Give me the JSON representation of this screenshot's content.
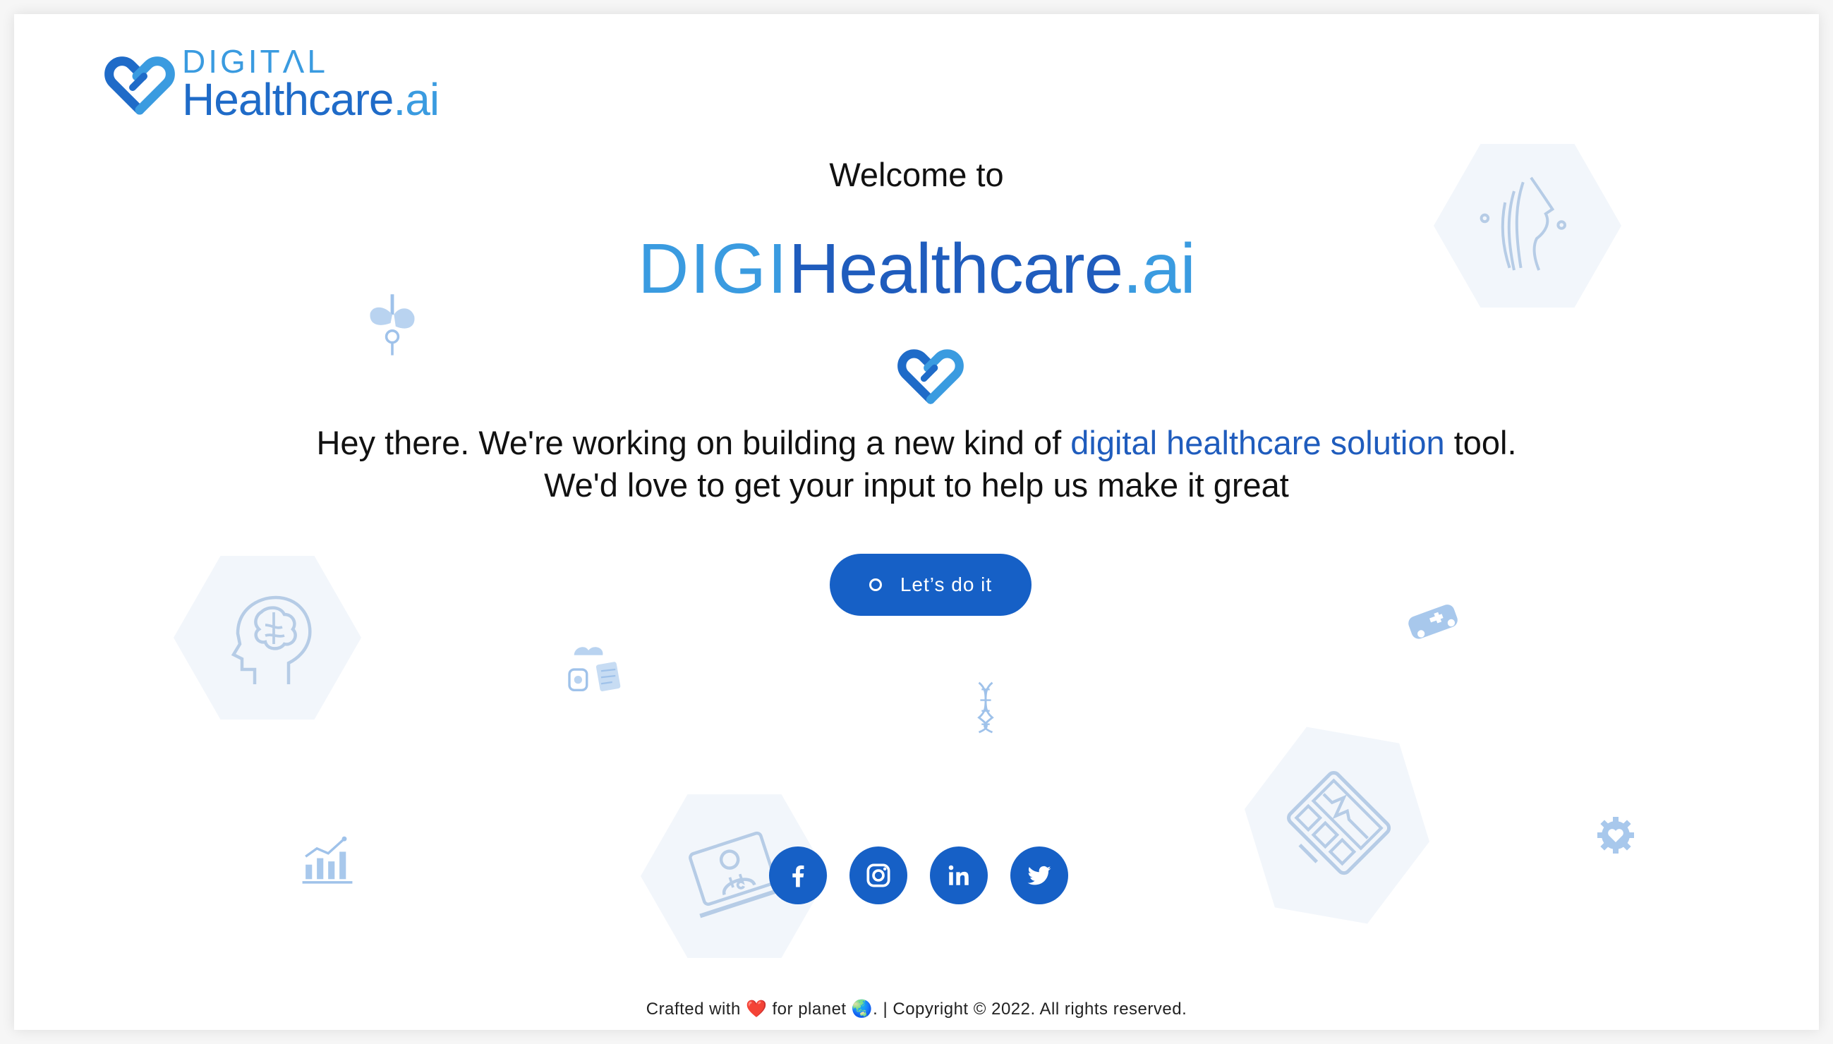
{
  "logo": {
    "line1": "DIGITΛL",
    "line2_main": "Healthcare",
    "line2_suffix": ".ai"
  },
  "hero": {
    "welcome": "Welcome to",
    "brand_digi": "DIGI",
    "brand_health": "Healthcare",
    "brand_ai": ".ai",
    "tagline_part1": "Hey there. We're working on building a new kind of ",
    "tagline_highlight": "digital healthcare solution",
    "tagline_part2": " tool.",
    "tagline_line2": "We'd love to get your input to help us make it great",
    "cta_label": "Let’s do it"
  },
  "social": [
    {
      "name": "facebook-button",
      "icon": "facebook-icon"
    },
    {
      "name": "instagram-button",
      "icon": "instagram-icon"
    },
    {
      "name": "linkedin-button",
      "icon": "linkedin-icon"
    },
    {
      "name": "twitter-button",
      "icon": "twitter-icon"
    }
  ],
  "footer": {
    "crafted": "Crafted with ",
    "heart": "❤️",
    "for_planet": " for planet ",
    "globe": "🌏",
    "copyright": ". | Copyright © 2022. All rights reserved."
  },
  "colors": {
    "primary": "#1660c6",
    "accent": "#3a9be0",
    "hex_bg": "#f2f6fb",
    "icon_tint": "#a9c8ea"
  }
}
